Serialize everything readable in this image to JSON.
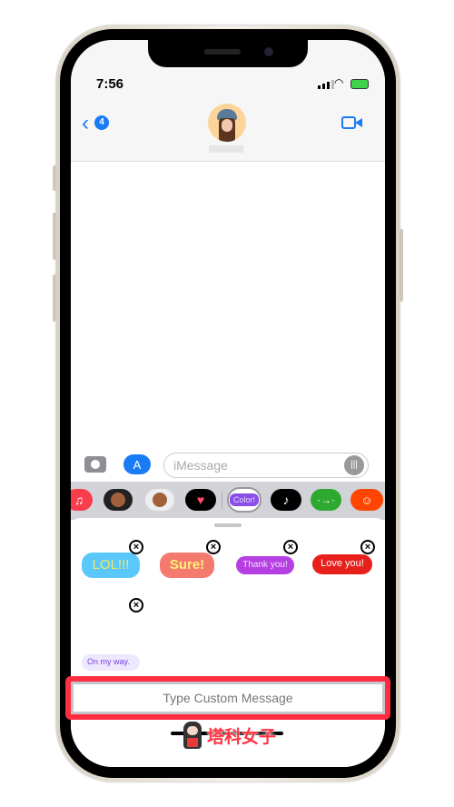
{
  "status": {
    "time": "7:56"
  },
  "header": {
    "back_count": "4"
  },
  "composer": {
    "placeholder": "iMessage"
  },
  "app_strip": {
    "items": [
      "music",
      "memoji",
      "memoji-stickers",
      "digital-touch",
      "color-text",
      "tiktok",
      "arrow-app",
      "reddit"
    ],
    "selected_label": "Color!"
  },
  "bubbles": [
    {
      "text": "LOL!!!",
      "bg": "#5ac8fa",
      "color": "#f5e663"
    },
    {
      "text": "Sure!",
      "bg": "#f47a70",
      "color": "#fff176"
    },
    {
      "text": "Thank you!",
      "bg": "#b53fe0",
      "color": "#f3e0ff"
    },
    {
      "text": "Love you!",
      "bg": "#e8201c",
      "color": "#ffffff"
    },
    {
      "text": "On my way.",
      "bg": "#eee8ff",
      "color": "#7a3fe0"
    }
  ],
  "custom": {
    "placeholder": "Type Custom Message"
  },
  "watermark": {
    "text": "塔科女子"
  },
  "colors": {
    "accent": "#1a7cf5",
    "highlight": "#ff2d3f"
  }
}
